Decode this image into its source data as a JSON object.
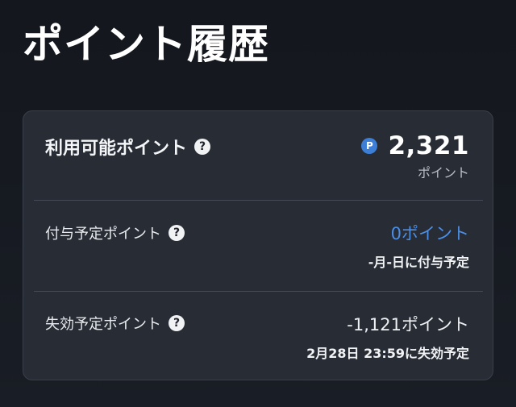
{
  "page": {
    "title": "ポイント履歴"
  },
  "card": {
    "available": {
      "label": "利用可能ポイント",
      "help_icon": "?",
      "badge": "P",
      "value": "2,321",
      "unit": "ポイント"
    },
    "grant": {
      "label": "付与予定ポイント",
      "help_icon": "?",
      "value": "0ポイント",
      "note": "-月-日に付与予定"
    },
    "expire": {
      "label": "失効予定ポイント",
      "help_icon": "?",
      "value": "-1,121ポイント",
      "note": "2月28日 23:59に失効予定"
    }
  },
  "colors": {
    "background": "#14171d",
    "card": "#272c35",
    "accent_blue": "#4b8ee6",
    "badge_blue": "#3d7fd6"
  }
}
